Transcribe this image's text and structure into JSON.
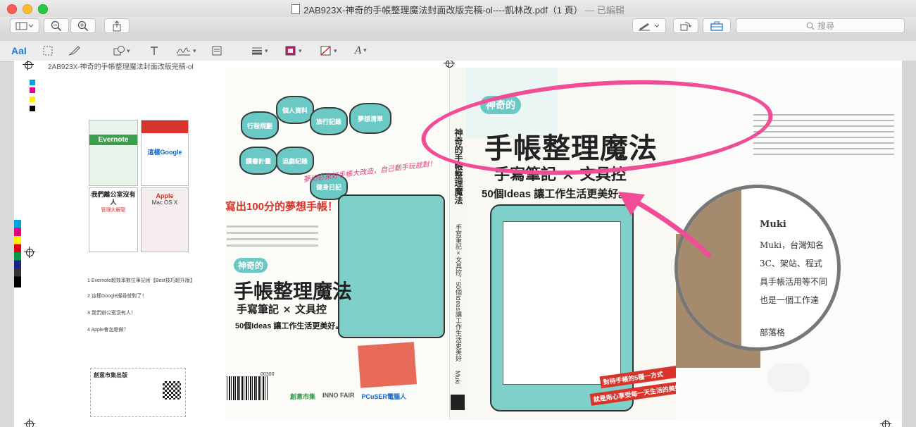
{
  "window": {
    "title": "2AB923X-神奇的手帳整理魔法封面改版完稿-ol----凱林改.pdf（1 頁）",
    "edited_label": "— 已編輯"
  },
  "toolbar": {
    "search_placeholder": "搜尋",
    "icons": [
      "sidebar-icon",
      "zoom-out-icon",
      "zoom-in-icon",
      "share-icon",
      "markup-pen-icon",
      "rotate-icon",
      "toolbox-icon"
    ]
  },
  "markup": {
    "text_tool_label": "AaI",
    "icons": [
      "selection-icon",
      "sketch-icon",
      "shapes-icon",
      "text-icon",
      "sign-icon",
      "note-icon",
      "line-style-icon",
      "border-color-icon",
      "fill-color-icon",
      "font-icon"
    ]
  },
  "document": {
    "header_name": "2AB923X-神奇的手帳整理魔法封面改版完稿-ol",
    "back_books": [
      {
        "title": "Evernote",
        "subtitle": ""
      },
      {
        "title": "這樣Google",
        "subtitle": ""
      },
      {
        "title": "我們離公室沒有人",
        "subtitle": "管理大解密"
      },
      {
        "title": "Apple",
        "subtitle": "Mac OS X"
      }
    ],
    "back_list": [
      "1 Evernote超效率數位筆記術【Best技巧超升版】",
      "2 這樣Google搜尋就對了！",
      "3 我們辦公室沒有人！",
      "4 Apple會怎麼做？"
    ],
    "flap_title": "創意市集出版",
    "cover": {
      "series_badge": "神奇的",
      "title": "手帳整理魔法",
      "subtitle": "手寫筆記 × 文具控",
      "tagline": "50個Ideas 讓工作生活更美好。",
      "slogan": "寫出100分的夢想手帳！",
      "handwriting": "夢幻必來好手帳大改造，自己動手玩就對！",
      "clouds": [
        "行程規劃",
        "個人資料",
        "旅行記錄",
        "夢想清單",
        "讀書計畫",
        "追劇紀錄",
        "健身日記"
      ]
    },
    "spine": {
      "title": "神奇的手帳整理魔法",
      "subtitle": "手寫筆記×文具控：50個Ideas讓工作生活更美好",
      "author": "Muki"
    },
    "publisher": [
      "創意市集",
      "INNO FAIR",
      "PCuSER電腦人"
    ],
    "isbn_text": "00300",
    "front": {
      "banner": "對待手帳的5種一方式",
      "banner2": "就是用心享受每一天生活的美好！"
    },
    "magnifier": {
      "heading": "Muki",
      "lines": [
        "Muki，台灣知名",
        "3C、架站、程式",
        "具手帳活用等不同",
        "也是一個工作達"
      ],
      "footer": "部落格"
    }
  }
}
